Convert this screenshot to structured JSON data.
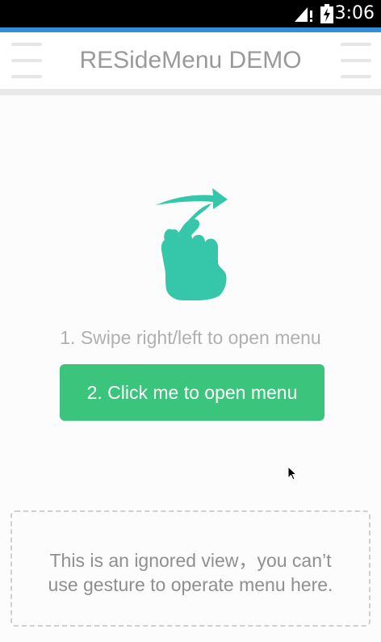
{
  "status_bar": {
    "time": "3:06",
    "signal_icon": "signal-no-data-icon",
    "battery_icon": "battery-charging-icon"
  },
  "app_bar": {
    "title": "RESideMenu DEMO",
    "left_button_icon": "hamburger-menu-icon",
    "right_button_icon": "hamburger-menu-icon"
  },
  "main": {
    "gesture_icon": "swipe-gesture-icon",
    "instruction": "1. Swipe right/left to open menu",
    "open_button_label": "2. Click me to open menu"
  },
  "ignored_view": {
    "line1": "This is an ignored view，you can’t",
    "line2": "use gesture to operate menu here."
  },
  "colors": {
    "status_bar": "#000000",
    "accent_line": "#2f8fd6",
    "title_text": "#9a9a9a",
    "menu_icon": "#e6e6e6",
    "gesture_icon": "#36c6a9",
    "button_background": "#3ac47c",
    "button_text": "#ffffff",
    "instruction_text": "#b0b0b0",
    "ignored_text": "#8f8f8f",
    "dashed_border": "#cfcfcf"
  }
}
